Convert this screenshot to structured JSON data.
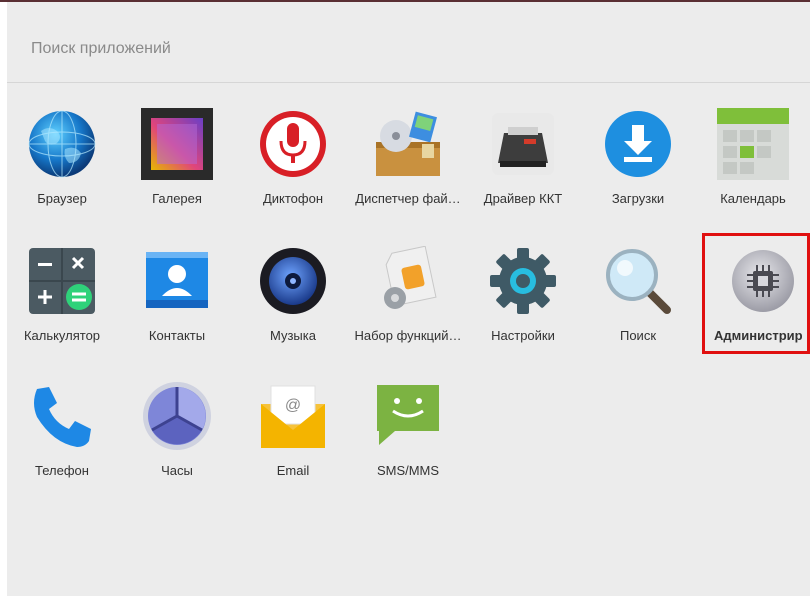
{
  "search": {
    "placeholder": "Поиск приложений"
  },
  "apps": [
    {
      "label": "Браузер",
      "icon": "globe-icon"
    },
    {
      "label": "Галерея",
      "icon": "gallery-icon"
    },
    {
      "label": "Диктофон",
      "icon": "microphone-icon"
    },
    {
      "label": "Диспетчер фай…",
      "icon": "file-manager-icon"
    },
    {
      "label": "Драйвер ККТ",
      "icon": "printer-icon"
    },
    {
      "label": "Загрузки",
      "icon": "download-icon"
    },
    {
      "label": "Календарь",
      "icon": "calendar-icon"
    },
    {
      "label": "Калькулятор",
      "icon": "calculator-icon"
    },
    {
      "label": "Контакты",
      "icon": "contacts-icon"
    },
    {
      "label": "Музыка",
      "icon": "speaker-icon"
    },
    {
      "label": "Набор функций…",
      "icon": "sim-toolkit-icon"
    },
    {
      "label": "Настройки",
      "icon": "settings-gear-icon"
    },
    {
      "label": "Поиск",
      "icon": "magnifier-icon"
    },
    {
      "label": "Администрир",
      "icon": "chip-icon"
    },
    {
      "label": "Телефон",
      "icon": "phone-icon"
    },
    {
      "label": "Часы",
      "icon": "clock-icon"
    },
    {
      "label": "Email",
      "icon": "email-icon"
    },
    {
      "label": "SMS/MMS",
      "icon": "sms-icon"
    }
  ],
  "highlight_color": "#e01010"
}
